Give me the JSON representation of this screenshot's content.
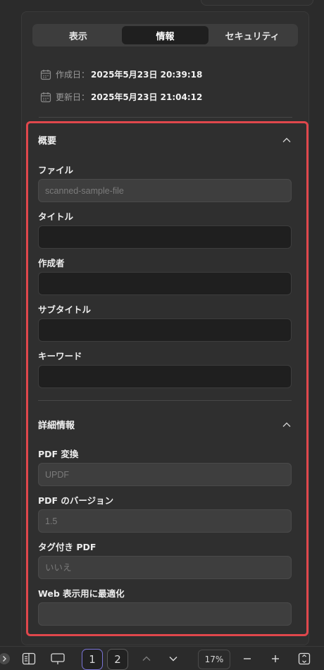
{
  "tabs": [
    {
      "label": "表示",
      "active": false
    },
    {
      "label": "情報",
      "active": true
    },
    {
      "label": "セキュリティ",
      "active": false
    }
  ],
  "dates": {
    "created_label": "作成日：",
    "created_value": "2025年5月23日 20:39:18",
    "modified_label": "更新日：",
    "modified_value": "2025年5月23日 21:04:12"
  },
  "summary": {
    "title": "概要",
    "file_label": "ファイル",
    "file_placeholder": "scanned-sample-file",
    "title_label": "タイトル",
    "title_value": "",
    "author_label": "作成者",
    "author_value": "",
    "subtitle_label": "サブタイトル",
    "subtitle_value": "",
    "keywords_label": "キーワード",
    "keywords_value": ""
  },
  "details": {
    "title": "詳細情報",
    "producer_label": "PDF 変換",
    "producer_value": "UPDF",
    "version_label": "PDF のバージョン",
    "version_value": "1.5",
    "tagged_label": "タグ付き PDF",
    "tagged_value": "いいえ",
    "fast_web_label": "Web 表示用に最適化",
    "fast_web_value": ""
  },
  "bottom_bar": {
    "page_1": "1",
    "page_2": "2",
    "zoom": "17%"
  },
  "colors": {
    "highlight_border": "#e0474c",
    "current_page_border": "#7a74d6"
  }
}
